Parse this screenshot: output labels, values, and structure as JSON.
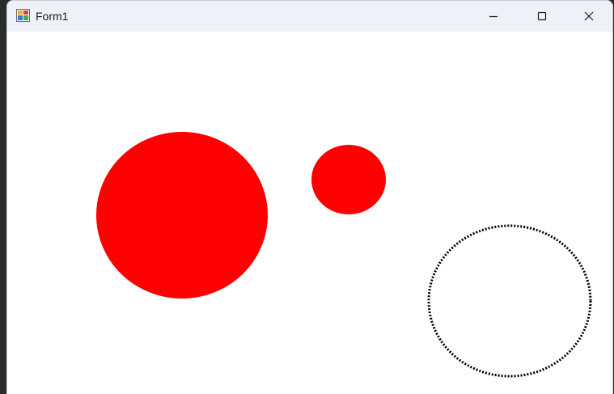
{
  "window": {
    "title": "Form1",
    "icon": "winforms-app-icon",
    "controls": {
      "minimize_icon": "minimize-icon",
      "maximize_icon": "maximize-icon",
      "close_icon": "close-icon"
    }
  },
  "canvas": {
    "background": "#ffffff",
    "shapes": [
      {
        "name": "large-red-circle",
        "kind": "filled-circle",
        "fill": "#ff0000"
      },
      {
        "name": "small-red-circle",
        "kind": "filled-circle",
        "fill": "#ff0000"
      },
      {
        "name": "dotted-circle-outline",
        "kind": "dotted-outline-circle",
        "stroke": "#000000"
      }
    ]
  }
}
